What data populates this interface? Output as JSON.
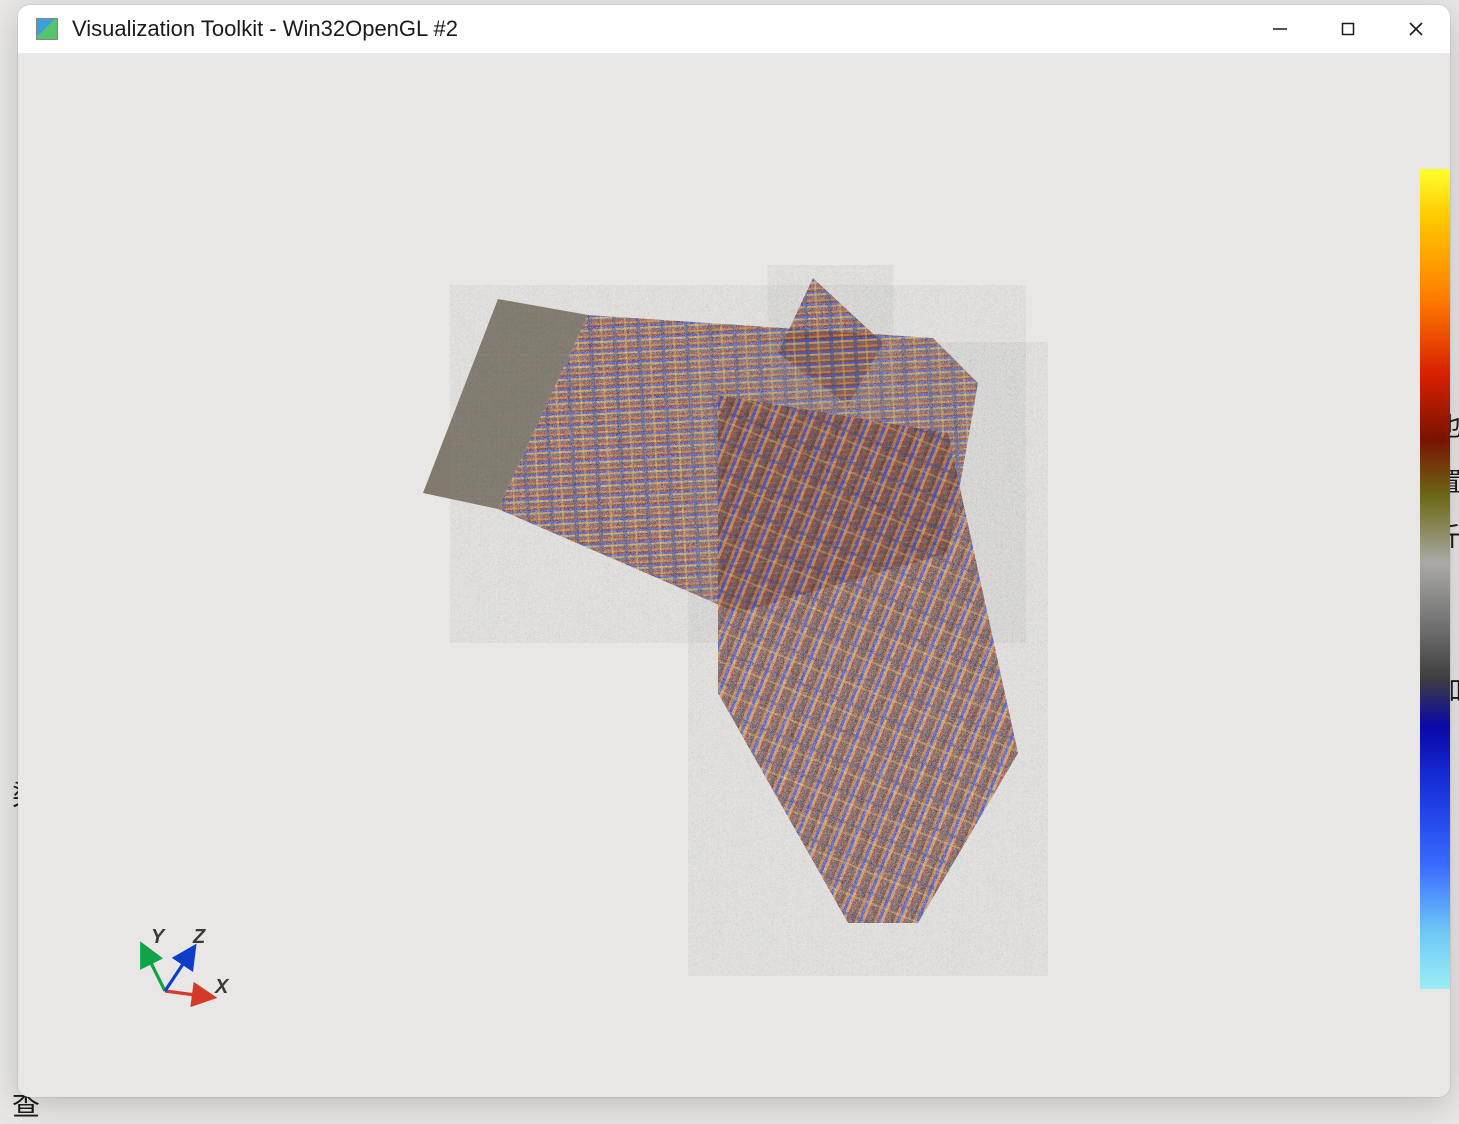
{
  "window": {
    "title": "Visualization Toolkit - Win32OpenGL #2"
  },
  "axes": {
    "x": "X",
    "y": "Y",
    "z": "Z",
    "x_color": "#d33a2a",
    "y_color": "#0fa547",
    "z_color": "#0e3ec9"
  },
  "colorbar": {
    "stops": [
      {
        "pct": 0,
        "color": "#ffff2e"
      },
      {
        "pct": 6,
        "color": "#ffc800"
      },
      {
        "pct": 16,
        "color": "#ff7a00"
      },
      {
        "pct": 25,
        "color": "#d82000"
      },
      {
        "pct": 33,
        "color": "#7a1300"
      },
      {
        "pct": 40,
        "color": "#6b6a17"
      },
      {
        "pct": 48,
        "color": "#aaa9a6"
      },
      {
        "pct": 56,
        "color": "#6f6f6f"
      },
      {
        "pct": 62,
        "color": "#3f3f3f"
      },
      {
        "pct": 68,
        "color": "#0a08a8"
      },
      {
        "pct": 76,
        "color": "#1a36e0"
      },
      {
        "pct": 85,
        "color": "#3a6cff"
      },
      {
        "pct": 93,
        "color": "#6cc7f5"
      },
      {
        "pct": 100,
        "color": "#9beef6"
      }
    ]
  },
  "background": {
    "left_chars": [
      "染",
      "查"
    ],
    "right_chars": [
      "也",
      "置",
      "斤",
      "加"
    ]
  }
}
